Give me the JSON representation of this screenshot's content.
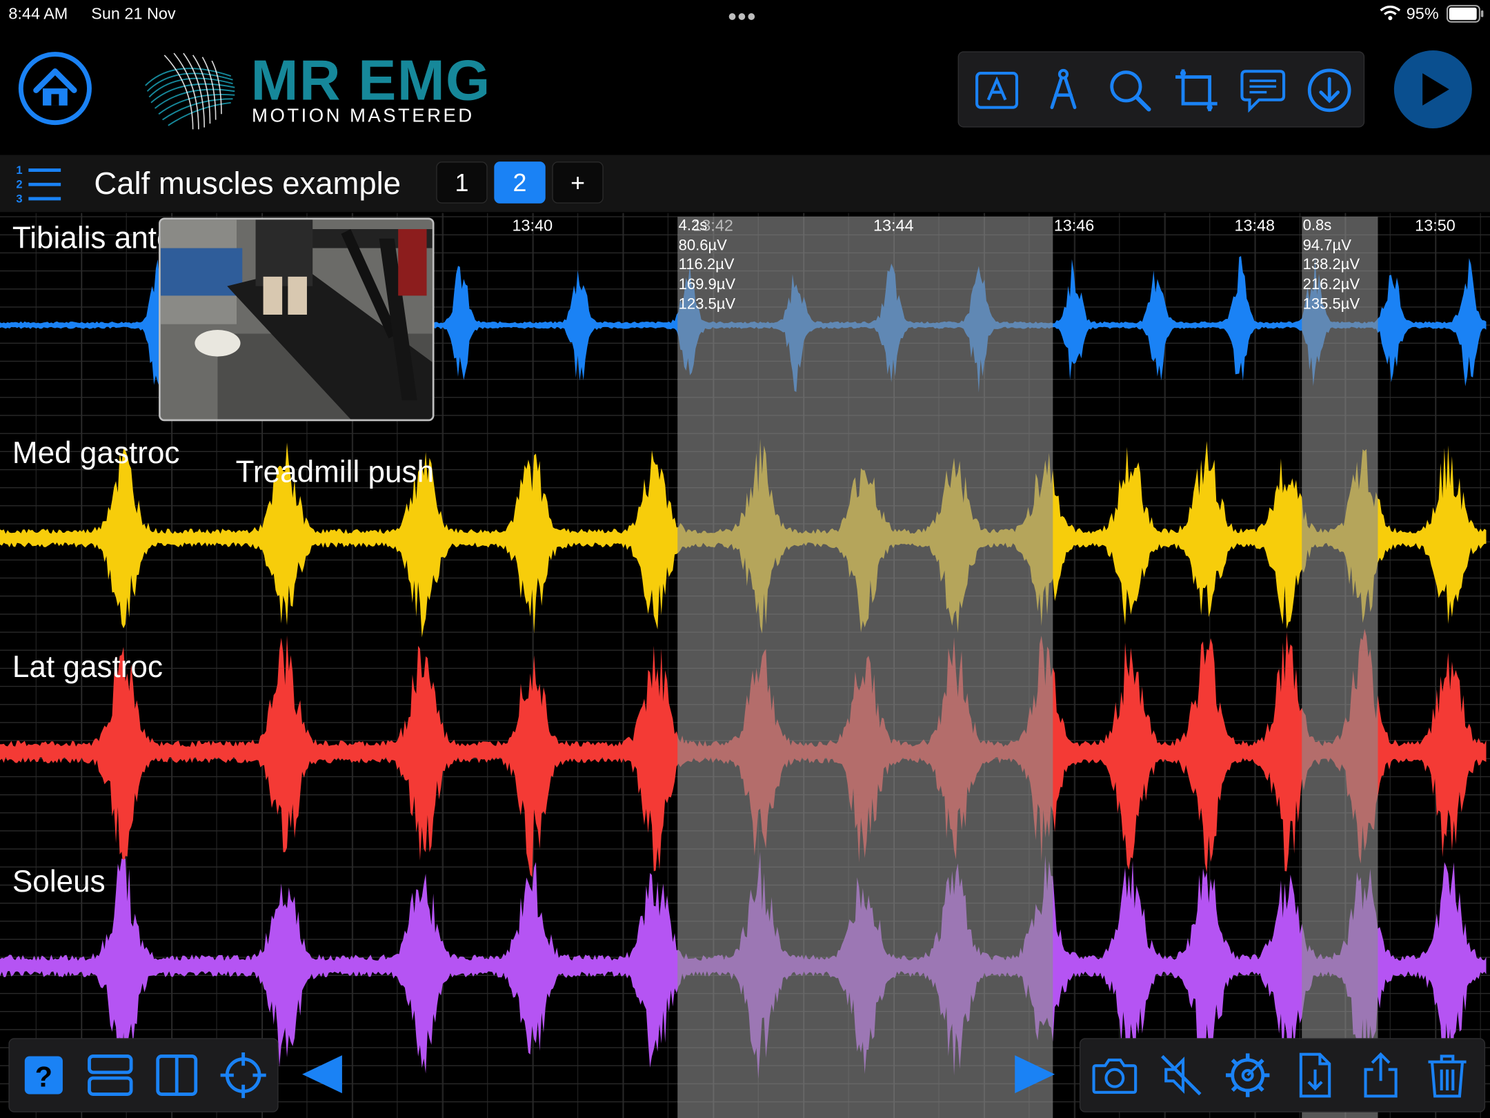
{
  "status": {
    "time": "8:44 AM",
    "date": "Sun 21 Nov",
    "battery": "95%"
  },
  "header": {
    "brand_name": "MR EMG",
    "tagline": "MOTION MASTERED",
    "tools": [
      "text-annotation-icon",
      "compass-icon",
      "search-icon",
      "crop-icon",
      "comment-icon",
      "download-icon"
    ]
  },
  "recording": {
    "title": "Calf muscles example",
    "pages": [
      "1",
      "2"
    ],
    "add_label": "+",
    "active_page": "2"
  },
  "plot": {
    "time_labels": [
      "13:40",
      "13:42",
      "13:44",
      "13:46",
      "13:48",
      "13:50"
    ],
    "selection_a": {
      "duration": "4.2s",
      "values": [
        "80.6µV",
        "116.2µV",
        "169.9µV",
        "123.5µV"
      ]
    },
    "selection_b": {
      "duration": "0.8s",
      "values": [
        "94.7µV",
        "138.2µV",
        "216.2µV",
        "135.5µV"
      ]
    },
    "marker_label": "Treadmill push"
  },
  "channels": [
    {
      "name": "Tibialis anterior",
      "color": "#1a82f5"
    },
    {
      "name": "Med gastroc",
      "color": "#f7cd0b"
    },
    {
      "name": "Lat gastroc",
      "color": "#f43a35"
    },
    {
      "name": "Soleus",
      "color": "#b554f3"
    }
  ],
  "bottom_left_tools": [
    "help-icon",
    "stacked-layout-icon",
    "split-layout-icon",
    "crosshair-icon"
  ],
  "bottom_right_tools": [
    "camera-icon",
    "mute-icon",
    "settings-icon",
    "export-file-icon",
    "share-icon",
    "trash-icon"
  ],
  "colors": {
    "accent": "#1a82f5",
    "brand": "#16889a",
    "selection": "#8c8c8c"
  }
}
